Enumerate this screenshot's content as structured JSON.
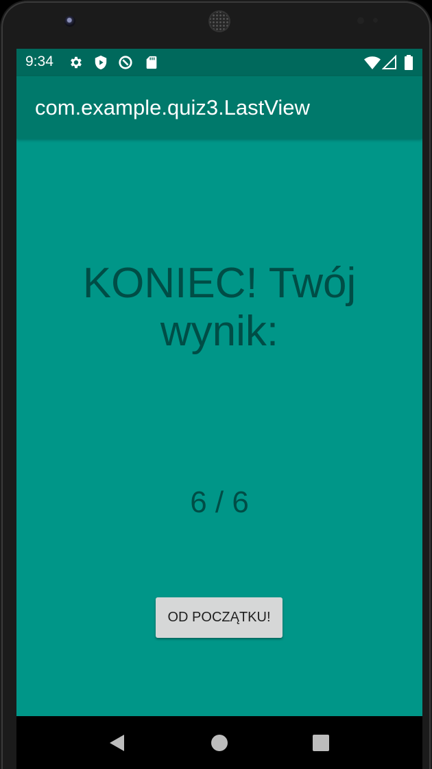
{
  "status_bar": {
    "time": "9:34",
    "left_icons": [
      "settings-icon",
      "shield-play-icon",
      "data-saver-icon",
      "sd-card-icon"
    ],
    "right_icons": [
      "wifi-icon",
      "cell-signal-icon",
      "battery-icon"
    ]
  },
  "app_bar": {
    "title": "com.example.quiz3.LastView"
  },
  "result": {
    "heading_line1": "KONIEC! Twój",
    "heading_line2": "wynik:",
    "score": "6 / 6"
  },
  "restart_button": {
    "label": "OD POCZĄTKU!"
  },
  "nav_bar": {
    "buttons": [
      "back-icon",
      "home-icon",
      "recents-icon"
    ]
  },
  "colors": {
    "screen_background": "#009688",
    "status_bar": "#00695c",
    "app_bar": "#00796b",
    "text_dark": "#004d46",
    "button": "#d6d7d7"
  }
}
